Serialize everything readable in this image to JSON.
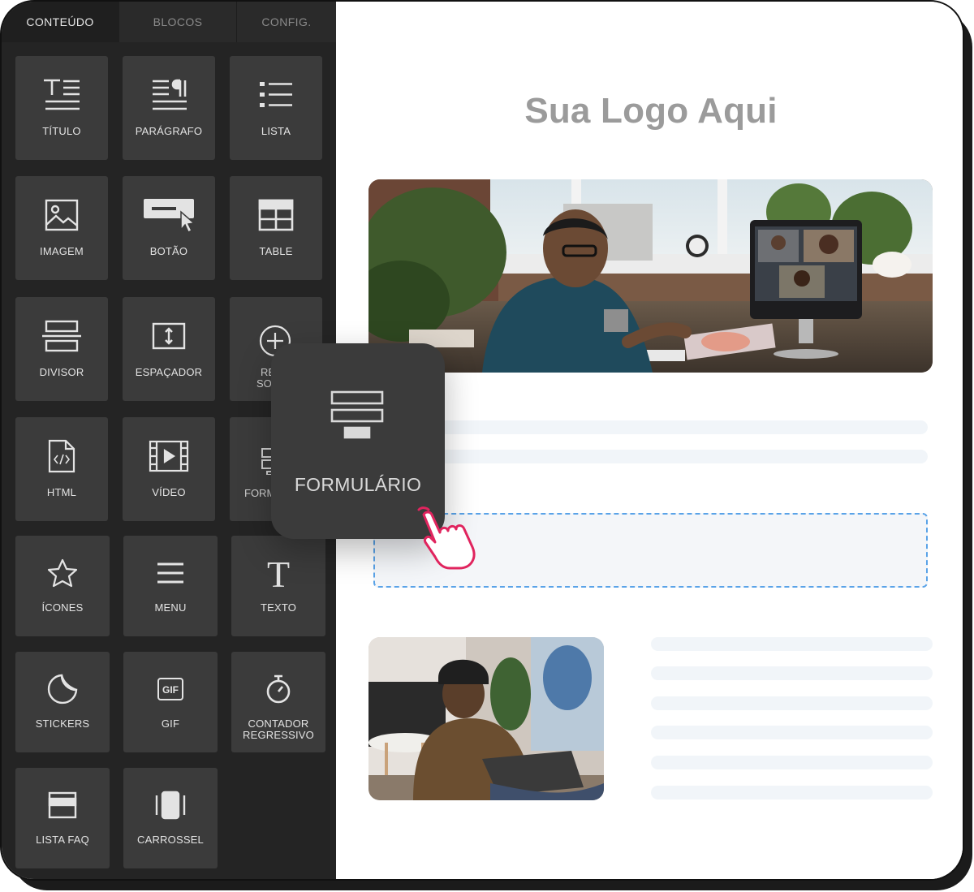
{
  "sidebar": {
    "tabs": [
      "CONTEÚDO",
      "BLOCOS",
      "CONFIG."
    ],
    "tiles": {
      "titulo": "TÍTULO",
      "paragrafo": "PARÁGRAFO",
      "lista": "LISTA",
      "imagem": "IMAGEM",
      "botao": "BOTÃO",
      "table": "TABLE",
      "divisor": "DIVISOR",
      "espacador": "ESPAÇADOR",
      "redes_partial_1": "RE",
      "redes_partial_2": "SO",
      "html": "HTML",
      "video": "VÍDEO",
      "formulario_partial": "FORM",
      "icones": "ÍCONES",
      "menu": "MENU",
      "texto": "TEXTO",
      "stickers": "STICKERS",
      "gif": "GIF",
      "contador_1": "CONTADOR",
      "contador_2": "REGRESSIVO",
      "lista_faq": "LISTA FAQ",
      "carrossel": "CARROSSEL"
    }
  },
  "drag_card": {
    "label": "FORMULÁRIO"
  },
  "canvas": {
    "logo": "Sua Logo Aqui"
  },
  "colors": {
    "sidebar": "#242424",
    "tile": "#3b3b3b",
    "dropzone_border": "#5aa3e8",
    "cursor": "#e0245e"
  }
}
